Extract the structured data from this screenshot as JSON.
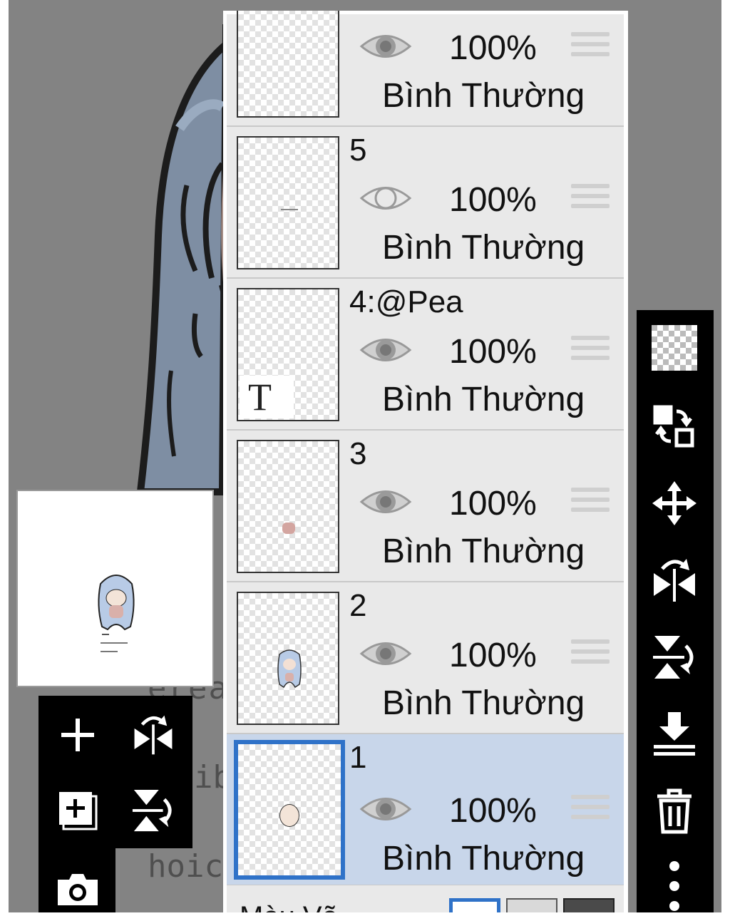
{
  "canvas": {
    "background_text_lines": [
      "érea",
      "ib",
      "hoic"
    ]
  },
  "layers": [
    {
      "name": "",
      "opacity": "100%",
      "blend_mode": "Bình Thường",
      "visible": true,
      "selected": false
    },
    {
      "name": "5",
      "opacity": "100%",
      "blend_mode": "Bình Thường",
      "visible": false,
      "selected": false
    },
    {
      "name": "4:@Pea",
      "opacity": "100%",
      "blend_mode": "Bình Thường",
      "visible": true,
      "selected": false,
      "is_text_layer": true,
      "text_badge": "T"
    },
    {
      "name": "3",
      "opacity": "100%",
      "blend_mode": "Bình Thường",
      "visible": true,
      "selected": false
    },
    {
      "name": "2",
      "opacity": "100%",
      "blend_mode": "Bình Thường",
      "visible": true,
      "selected": false
    },
    {
      "name": "1",
      "opacity": "100%",
      "blend_mode": "Bình Thường",
      "visible": true,
      "selected": true
    }
  ],
  "bottom": {
    "label": "Màu Vẽ"
  },
  "right_toolbar": [
    "transparency-icon",
    "swap-layers-icon",
    "move-icon",
    "flip-horizontal-icon",
    "flip-vertical-icon",
    "merge-down-icon",
    "trash-icon",
    "more-options-icon"
  ],
  "left_toolbar": [
    "add-layer-icon",
    "flip-horizontal-icon",
    "add-copy-layer-icon",
    "flip-vertical-icon",
    "camera-icon"
  ],
  "colors": {
    "selected_border": "#2f72c8",
    "selected_row": "#c8d6ea",
    "panel": "#e9e9e9",
    "toolbar": "#000000"
  }
}
